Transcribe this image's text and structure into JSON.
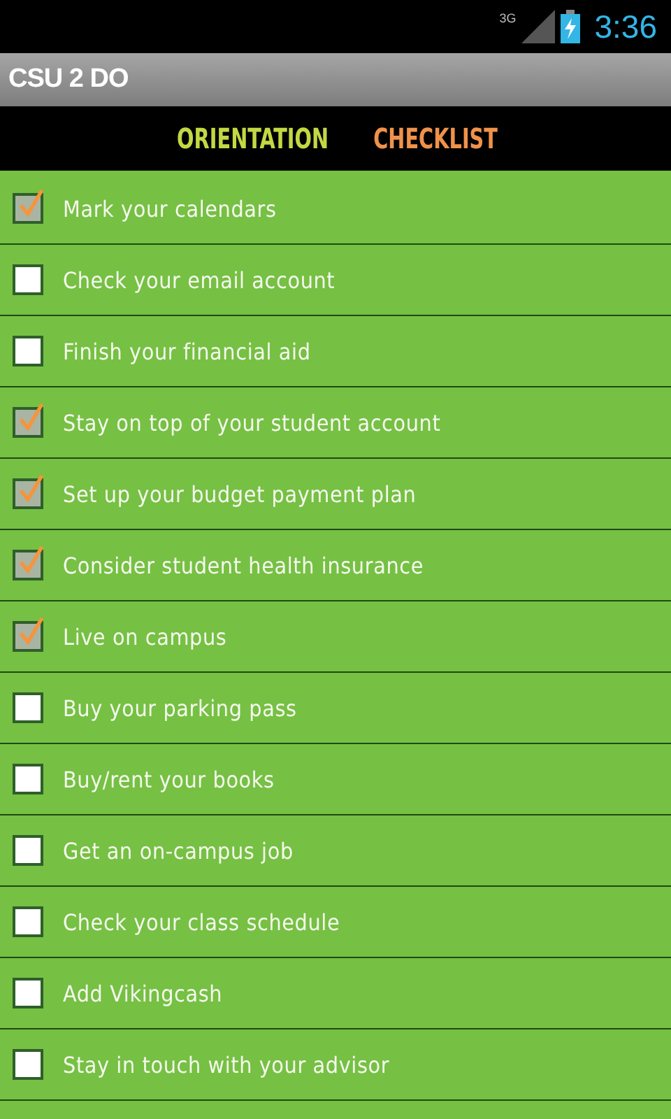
{
  "status_bar": {
    "network": "3G",
    "time": "3:36"
  },
  "app_bar": {
    "title": "CSU 2 DO"
  },
  "header": {
    "words": [
      "ORIENTATION",
      "CHECKLIST"
    ]
  },
  "items": [
    {
      "label": "Mark your calendars",
      "checked": true
    },
    {
      "label": "Check your email account",
      "checked": false
    },
    {
      "label": "Finish your financial aid",
      "checked": false
    },
    {
      "label": "Stay on top of your student account",
      "checked": true
    },
    {
      "label": "Set up your budget payment plan",
      "checked": true
    },
    {
      "label": "Consider student health insurance",
      "checked": true
    },
    {
      "label": "Live on campus",
      "checked": true
    },
    {
      "label": "Buy your parking pass",
      "checked": false
    },
    {
      "label": "Buy/rent your books",
      "checked": false
    },
    {
      "label": "Get an on-campus job",
      "checked": false
    },
    {
      "label": "Check your class schedule",
      "checked": false
    },
    {
      "label": "Add Vikingcash",
      "checked": false
    },
    {
      "label": "Stay in touch with your advisor",
      "checked": false
    }
  ]
}
